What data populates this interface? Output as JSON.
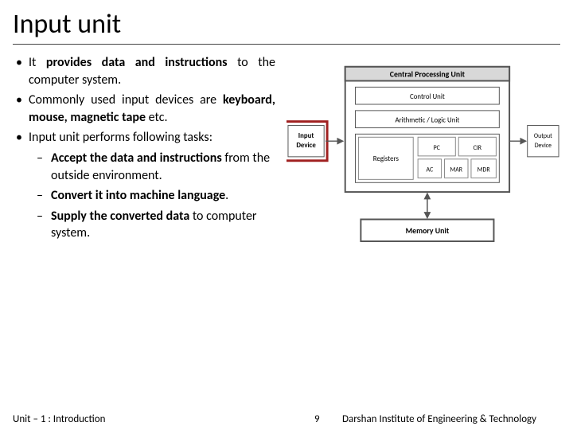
{
  "title": "Input unit",
  "bullets": {
    "b1a": "It",
    "b1b": " provides data and instructions",
    "b1c": " to the computer system.",
    "b2a": "Commonly used input devices are ",
    "b2b": "keyboard, mouse, magnetic tape",
    "b2c": " etc.",
    "b3": "Input unit performs following tasks:",
    "s1a": "Accept the data and instructions",
    "s1b": " from the outside environment.",
    "s2a": "Convert it into machine language",
    "s2b": ".",
    "s3a": "Supply the converted data",
    "s3b": " to computer system."
  },
  "diagram": {
    "input": "Input Device",
    "cpu": "Central Processing Unit",
    "control": "Control Unit",
    "alu": "Arithmetic / Logic Unit",
    "registers": "Registers",
    "pc": "PC",
    "cir": "CIR",
    "ac": "AC",
    "mar": "MAR",
    "mdr": "MDR",
    "memory": "Memory Unit",
    "output": "Output Device"
  },
  "footer": {
    "unit": "Unit – 1 : Introduction",
    "page": "9",
    "inst": "Darshan Institute of Engineering & Technology"
  }
}
